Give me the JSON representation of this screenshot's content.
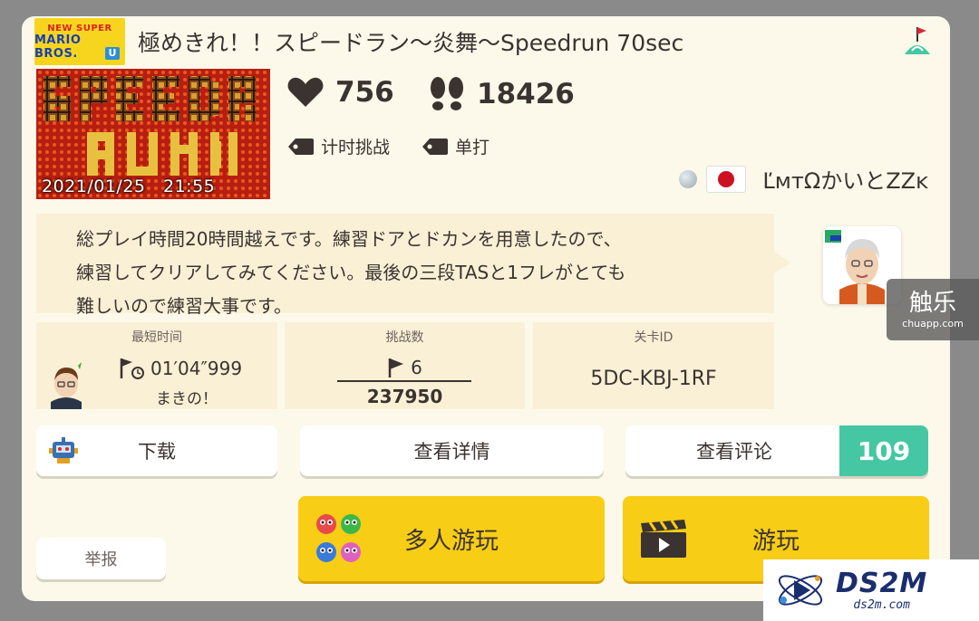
{
  "game": {
    "logo_line1": "NEW SUPER",
    "logo_line2": "MARIO BROS.",
    "logo_line3": "U"
  },
  "level": {
    "title": "極めきれ！！スピードラン〜炎舞〜Speedrun 70sec",
    "upload_datetime": "2021/01/25　21:55",
    "likes": "756",
    "plays": "18426",
    "tags": [
      "计时挑战",
      "单打"
    ],
    "description_lines": [
      "総プレイ時間20時間越えです。練習ドアとドカンを用意したので、",
      "練習してクリアしてみてください。最後の三段TASと1フレがとても",
      "難しいので練習大事です。"
    ]
  },
  "creator": {
    "name": "ĽᴍᴛΩかいとZZᴋ",
    "country_flag": "japan-flag"
  },
  "stats": {
    "best_time": {
      "label": "最短时间",
      "value": "01′04″999",
      "holder": "まきの！"
    },
    "attempts": {
      "label": "挑战数",
      "clears": "6",
      "total": "237950"
    },
    "course_id": {
      "label": "关卡ID",
      "value": "5DC-KBJ-1RF"
    }
  },
  "buttons": {
    "download": "下载",
    "details": "查看详情",
    "comments": "查看评论",
    "comment_count": "109",
    "report": "举报",
    "multiplayer": "多人游玩",
    "play": "游玩"
  },
  "watermarks": {
    "chuapp_cn": "触乐",
    "chuapp_url": "chuapp.com",
    "ds2m": "DS2M",
    "ds2m_url": "ds2m.com"
  },
  "colors": {
    "card_bg": "#fdf9ea",
    "panel_bg": "#faf0d6",
    "accent_yellow": "#f8cd15",
    "accent_green": "#45c7a3"
  }
}
